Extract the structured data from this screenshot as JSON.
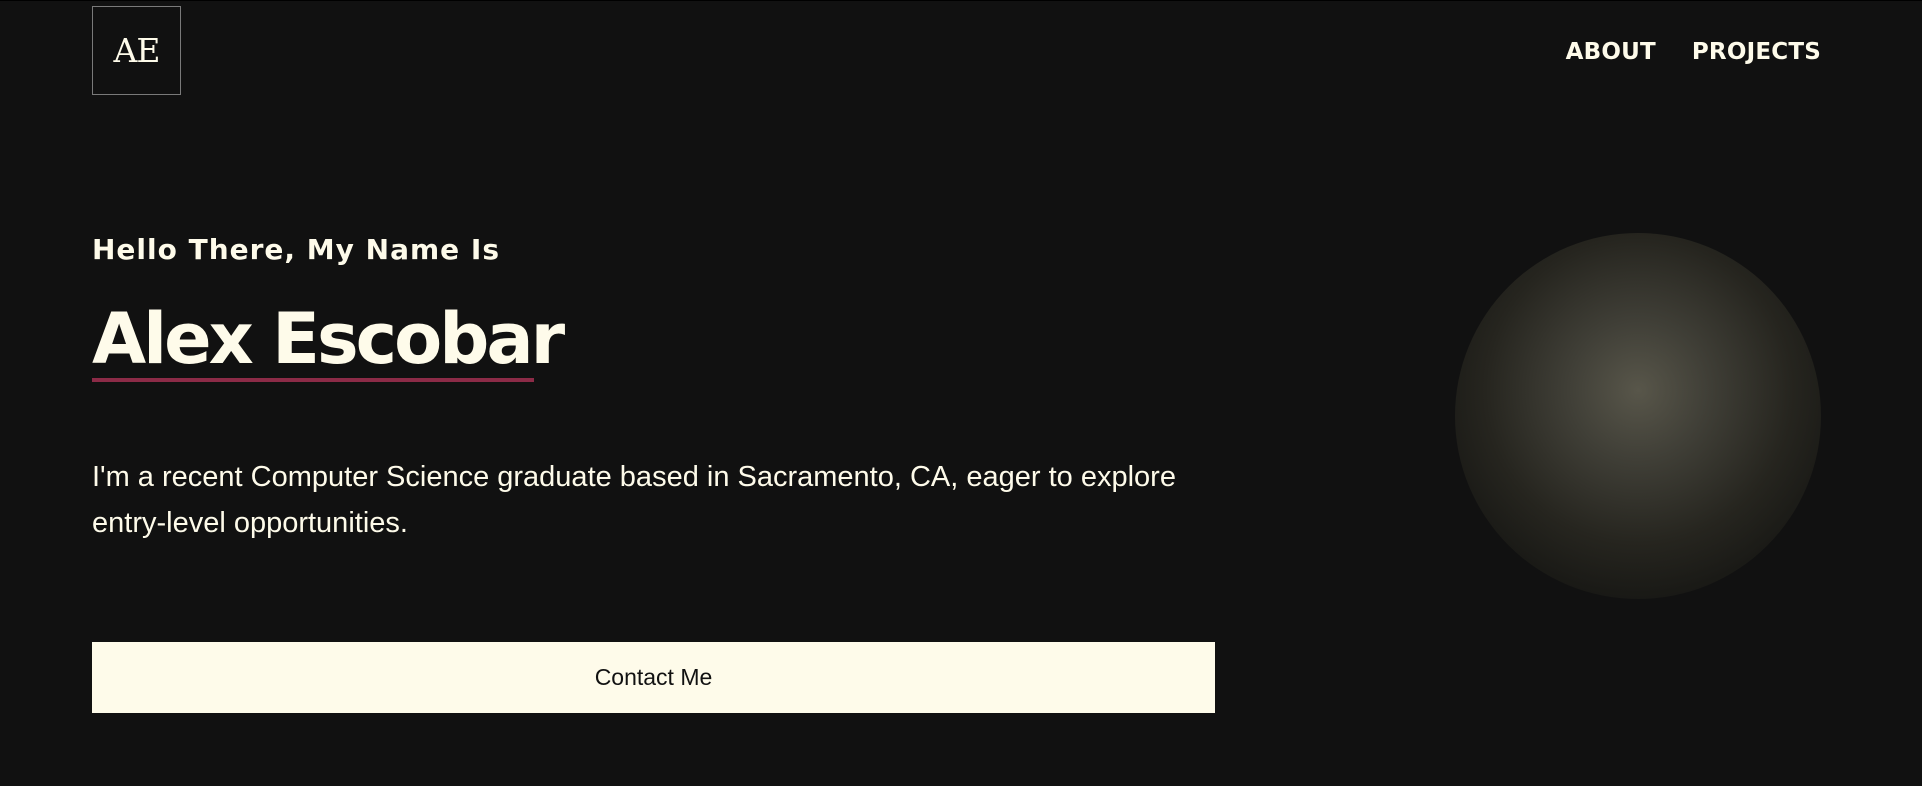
{
  "logo": {
    "text": "AE"
  },
  "nav": {
    "items": [
      {
        "label": "ABOUT"
      },
      {
        "label": "PROJECTS"
      }
    ]
  },
  "hero": {
    "greeting": "Hello There, My Name Is",
    "name": "Alex Escobar",
    "intro": "I'm a recent Computer Science graduate based in Sacramento, CA, eager to explore entry-level opportunities.",
    "cta_label": "Contact Me"
  },
  "colors": {
    "background": "#111111",
    "text": "#fefbea",
    "accent_underline": "#8c2b47",
    "button_background": "#fefbea"
  }
}
